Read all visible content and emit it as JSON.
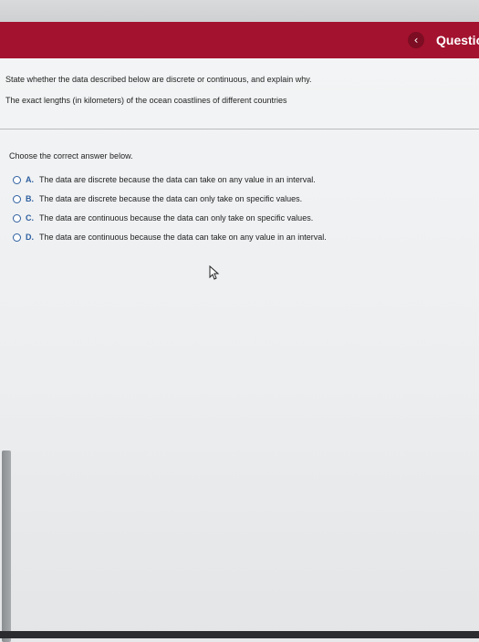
{
  "header": {
    "back_glyph": "‹",
    "question_label": "Questio"
  },
  "question": {
    "prompt_line1": "State whether the data described below are discrete or continuous, and explain why.",
    "prompt_line2": "The exact lengths (in kilometers) of the ocean coastlines of different countries"
  },
  "answer": {
    "instruction": "Choose the correct answer below.",
    "options": [
      {
        "letter": "A.",
        "text": "The data are discrete because the data can take on any value in an interval."
      },
      {
        "letter": "B.",
        "text": "The data are discrete because the data can only take on specific values."
      },
      {
        "letter": "C.",
        "text": "The data are continuous because the data can only take on specific values."
      },
      {
        "letter": "D.",
        "text": "The data are continuous because the data can take on any value in an interval."
      }
    ]
  },
  "colors": {
    "header_bar": "#a3122f",
    "radio_accent": "#2d5fa0"
  }
}
